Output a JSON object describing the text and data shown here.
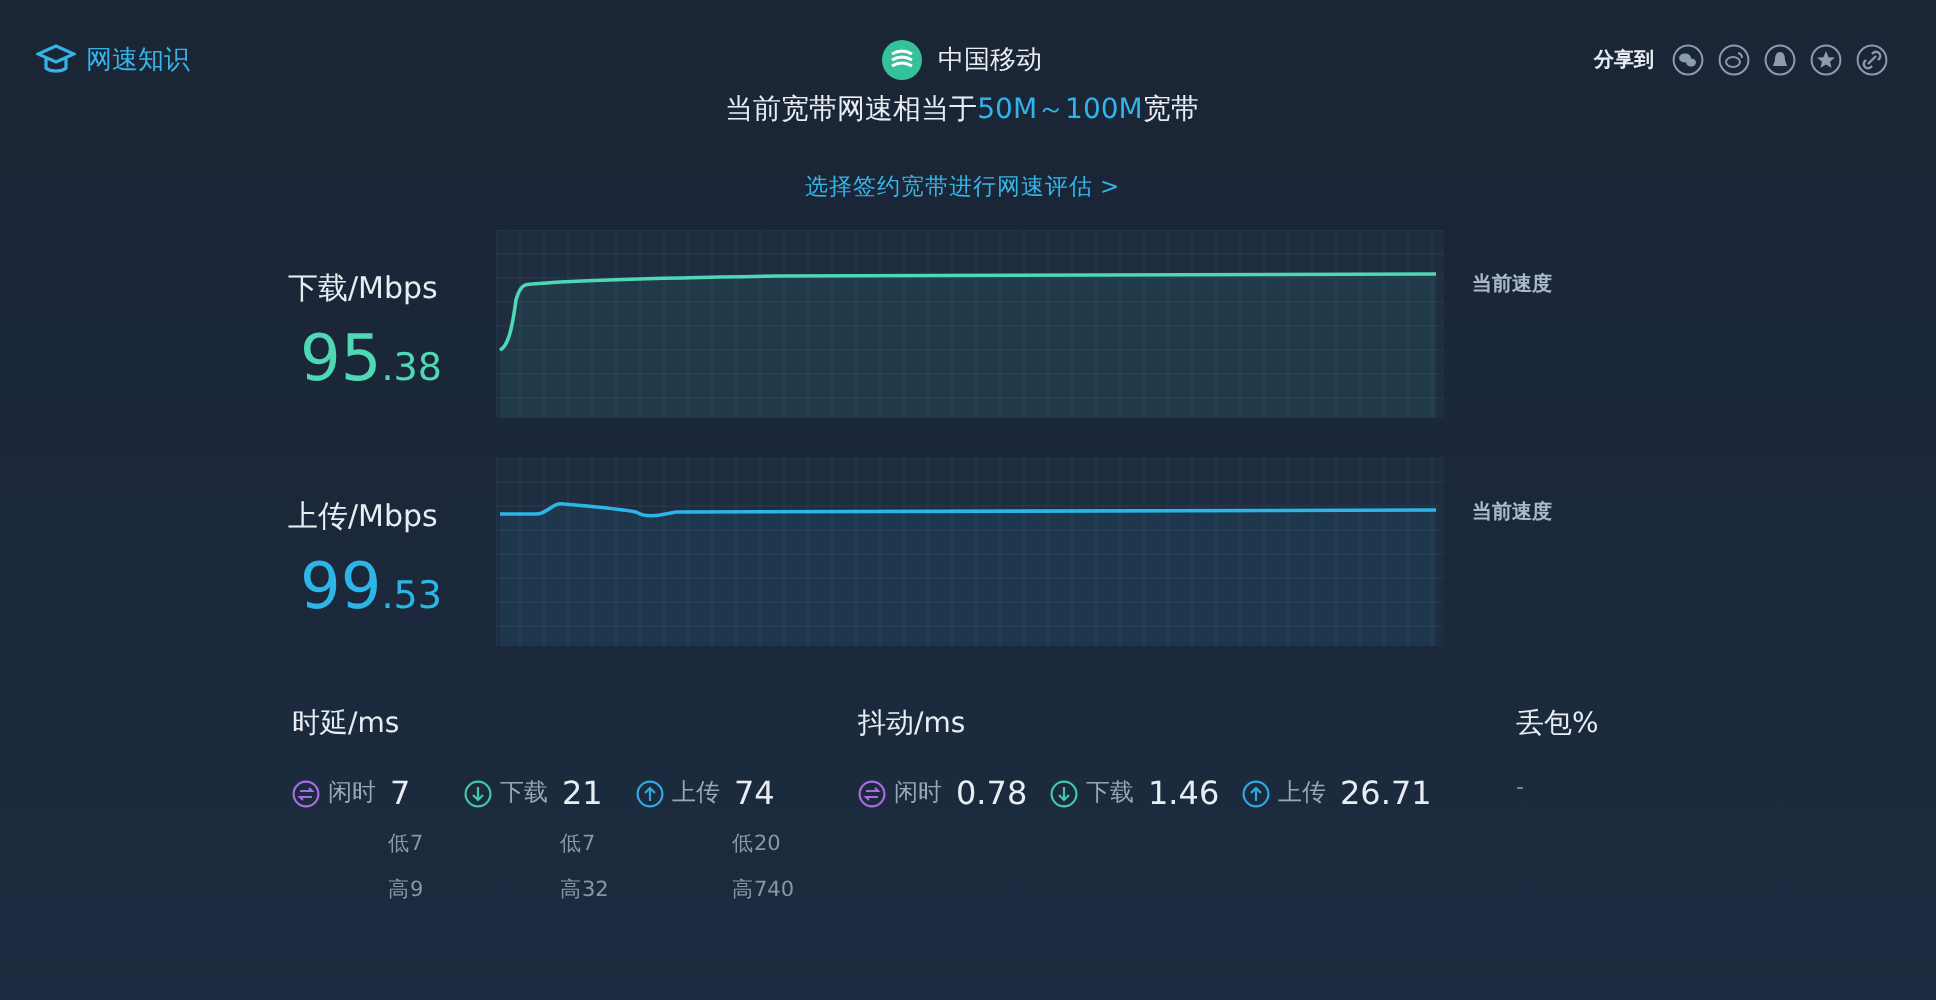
{
  "header": {
    "knowledge_link": "网速知识",
    "carrier": "中国移动",
    "share_label": "分享到",
    "share_icons": [
      {
        "kind": "wechat"
      },
      {
        "kind": "weibo"
      },
      {
        "kind": "qq"
      },
      {
        "kind": "favorite"
      },
      {
        "kind": "link"
      }
    ]
  },
  "headline": {
    "prefix": "当前宽带网速相当于",
    "highlight": "50M～100M",
    "suffix": "宽带"
  },
  "evaluate_link": "选择签约宽带进行网速评估 >",
  "speeds": [
    {
      "kind": "download",
      "label": "下载/Mbps",
      "integer": "95",
      "decimal": ".38",
      "current_label": "当前速度"
    },
    {
      "kind": "upload",
      "label": "上传/Mbps",
      "integer": "99",
      "decimal": ".53",
      "current_label": "当前速度"
    }
  ],
  "stats": [
    {
      "title": "时延/ms",
      "items": [
        {
          "kind": "idle",
          "label": "闲时",
          "value": "7",
          "low": "低7",
          "high": "高9"
        },
        {
          "kind": "download",
          "label": "下载",
          "value": "21",
          "low": "低7",
          "high": "高32"
        },
        {
          "kind": "upload",
          "label": "上传",
          "value": "74",
          "low": "低20",
          "high": "高740"
        }
      ]
    },
    {
      "title": "抖动/ms",
      "items": [
        {
          "kind": "idle",
          "label": "闲时",
          "value": "0.78"
        },
        {
          "kind": "download",
          "label": "下载",
          "value": "1.46"
        },
        {
          "kind": "upload",
          "label": "上传",
          "value": "26.71"
        }
      ]
    },
    {
      "title": "丢包%",
      "items": [
        {
          "kind": "none",
          "value": "-"
        }
      ]
    }
  ]
}
